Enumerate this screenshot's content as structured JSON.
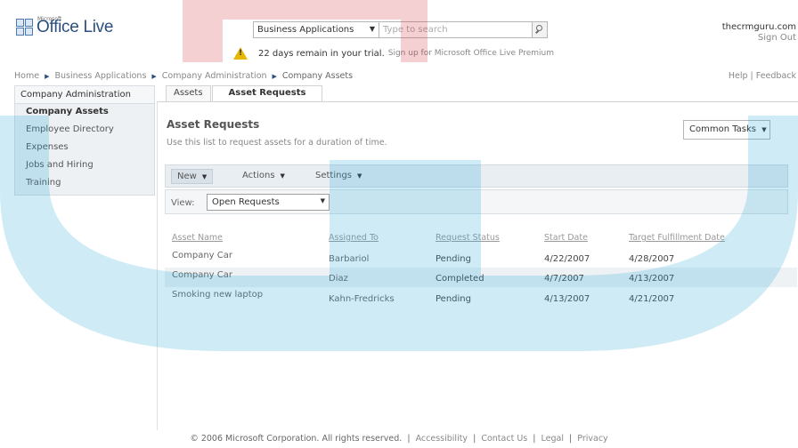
{
  "header": {
    "logo_small": "Microsoft",
    "logo_name": "Office Live",
    "search_scope": "Business Applications",
    "search_placeholder": "Type to search",
    "trial_message": "22 days remain in your trial.",
    "trial_link": "Sign up for Microsoft Office Live Premium",
    "user_name": "thecrmguru.com",
    "sign_out": "Sign Out",
    "help": "Help",
    "feedback": "Feedback"
  },
  "breadcrumb": [
    "Home",
    "Business Applications",
    "Company Administration",
    "Company Assets"
  ],
  "sidebar": {
    "heading": "Company Administration",
    "items": [
      {
        "label": "Company Assets",
        "selected": true
      },
      {
        "label": "Employee Directory"
      },
      {
        "label": "Expenses"
      },
      {
        "label": "Jobs and Hiring"
      },
      {
        "label": "Training"
      }
    ]
  },
  "tabs": [
    {
      "label": "Assets"
    },
    {
      "label": "Asset Requests",
      "active": true
    }
  ],
  "main": {
    "title": "Asset Requests",
    "description": "Use this list to request assets for a duration of time.",
    "common_tasks": "Common Tasks",
    "toolbar": {
      "new": "New",
      "actions": "Actions",
      "settings": "Settings"
    },
    "view_label": "View:",
    "view_value": "Open Requests"
  },
  "table": {
    "columns": [
      "Asset Name",
      "Assigned To",
      "Request Status",
      "Start Date",
      "Target Fulfillment Date"
    ],
    "rows": [
      [
        "Company Car",
        "Barbariol",
        "Pending",
        "4/22/2007",
        "4/28/2007"
      ],
      [
        "Company Car",
        "Diaz",
        "Completed",
        "4/7/2007",
        "4/13/2007"
      ],
      [
        "Smoking new laptop",
        "Kahn-Fredricks",
        "Pending",
        "4/13/2007",
        "4/21/2007"
      ]
    ]
  },
  "footer": {
    "copyright": "© 2006 Microsoft Corporation. All rights reserved.",
    "links": [
      "Accessibility",
      "Contact Us",
      "Legal",
      "Privacy"
    ]
  },
  "colors": {
    "brand": "#2b4f80",
    "watermark": "#1ea3d8",
    "watermark_accent": "#cc2a33",
    "warning": "#e8b800"
  }
}
